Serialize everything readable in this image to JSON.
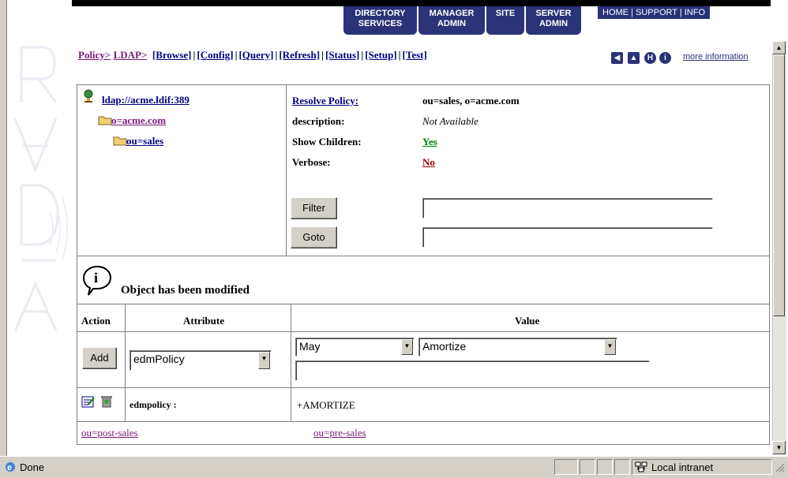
{
  "nav": {
    "tabs": [
      {
        "line1": "DIRECTORY",
        "line2": "SERVICES"
      },
      {
        "line1": "MANAGER",
        "line2": "ADMIN"
      },
      {
        "line1": "SITE",
        "line2": ""
      },
      {
        "line1": "SERVER",
        "line2": "ADMIN"
      }
    ],
    "right_links": [
      "HOME",
      "SUPPORT",
      "INFO"
    ]
  },
  "breadcrumb": {
    "policy": "Policy>",
    "ldap": "LDAP>",
    "actions": [
      "[Browse]",
      "[Config]",
      "[Query]",
      "[Refresh]",
      "[Status]",
      "[Setup]",
      "[Test]"
    ]
  },
  "more_info": "more information",
  "tree": {
    "root": "ldap://acme.ldif:389",
    "child": "o=acme.com",
    "grandchild": "ou=sales"
  },
  "details": {
    "resolve_label": "Resolve Policy:",
    "resolve_value": "ou=sales, o=acme.com",
    "description_label": "description:",
    "description_value": "Not Available",
    "children_label": "Show Children:",
    "children_value": "Yes",
    "verbose_label": "Verbose:",
    "verbose_value": "No",
    "filter_button": "Filter",
    "goto_button": "Goto",
    "filter_value": "",
    "goto_value": ""
  },
  "message": "Object has been modified",
  "table": {
    "headers": [
      "Action",
      "Attribute",
      "Value"
    ],
    "add_button": "Add",
    "attribute_select": "edmPolicy",
    "value_select1": "May",
    "value_select2": "Amortize",
    "value_text": "",
    "row_attr": "edmpolicy :",
    "row_value": "+AMORTIZE"
  },
  "children_links": [
    "ou=post-sales",
    "ou=pre-sales"
  ],
  "status": {
    "text": "Done",
    "zone": "Local intranet"
  },
  "colors": {
    "nav_bg": "#2a3278",
    "visited": "#7a1a7a",
    "link": "#000080",
    "yes": "#008000",
    "no": "#a00000"
  }
}
